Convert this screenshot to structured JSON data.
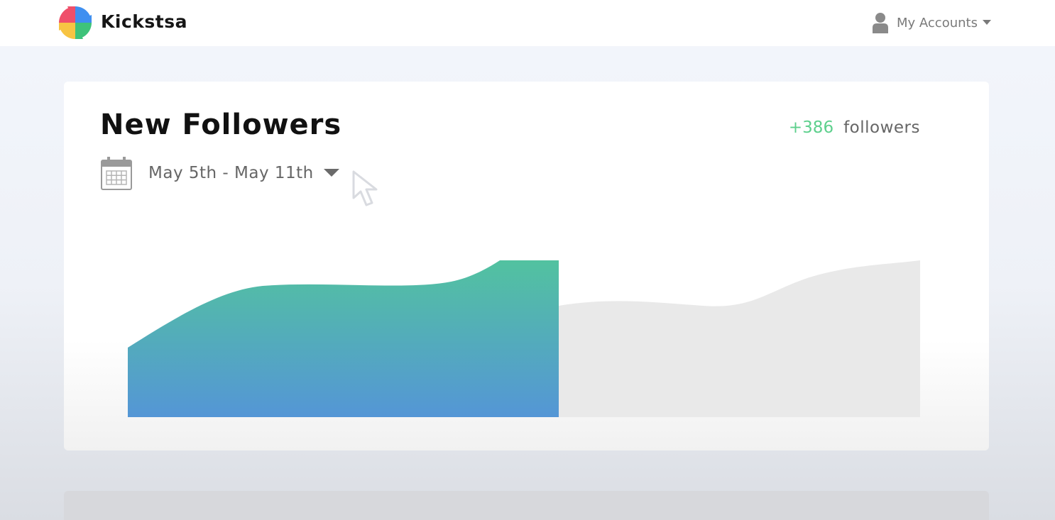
{
  "header": {
    "brand": "Kickstsa",
    "account_menu_label": "My Accounts"
  },
  "card": {
    "title": "New Followers",
    "follower_count": "+386",
    "follower_unit": "followers",
    "date_range": "May 5th - May 11th"
  },
  "colors": {
    "accent_green": "#5ed08d",
    "gradient_top": "#52cc93",
    "gradient_bottom": "#5496d6",
    "future_area": "#e9e9e9"
  },
  "icons": [
    "brand-logo-icon",
    "user-icon",
    "chevron-down-icon",
    "calendar-icon",
    "mouse-cursor-icon"
  ]
}
